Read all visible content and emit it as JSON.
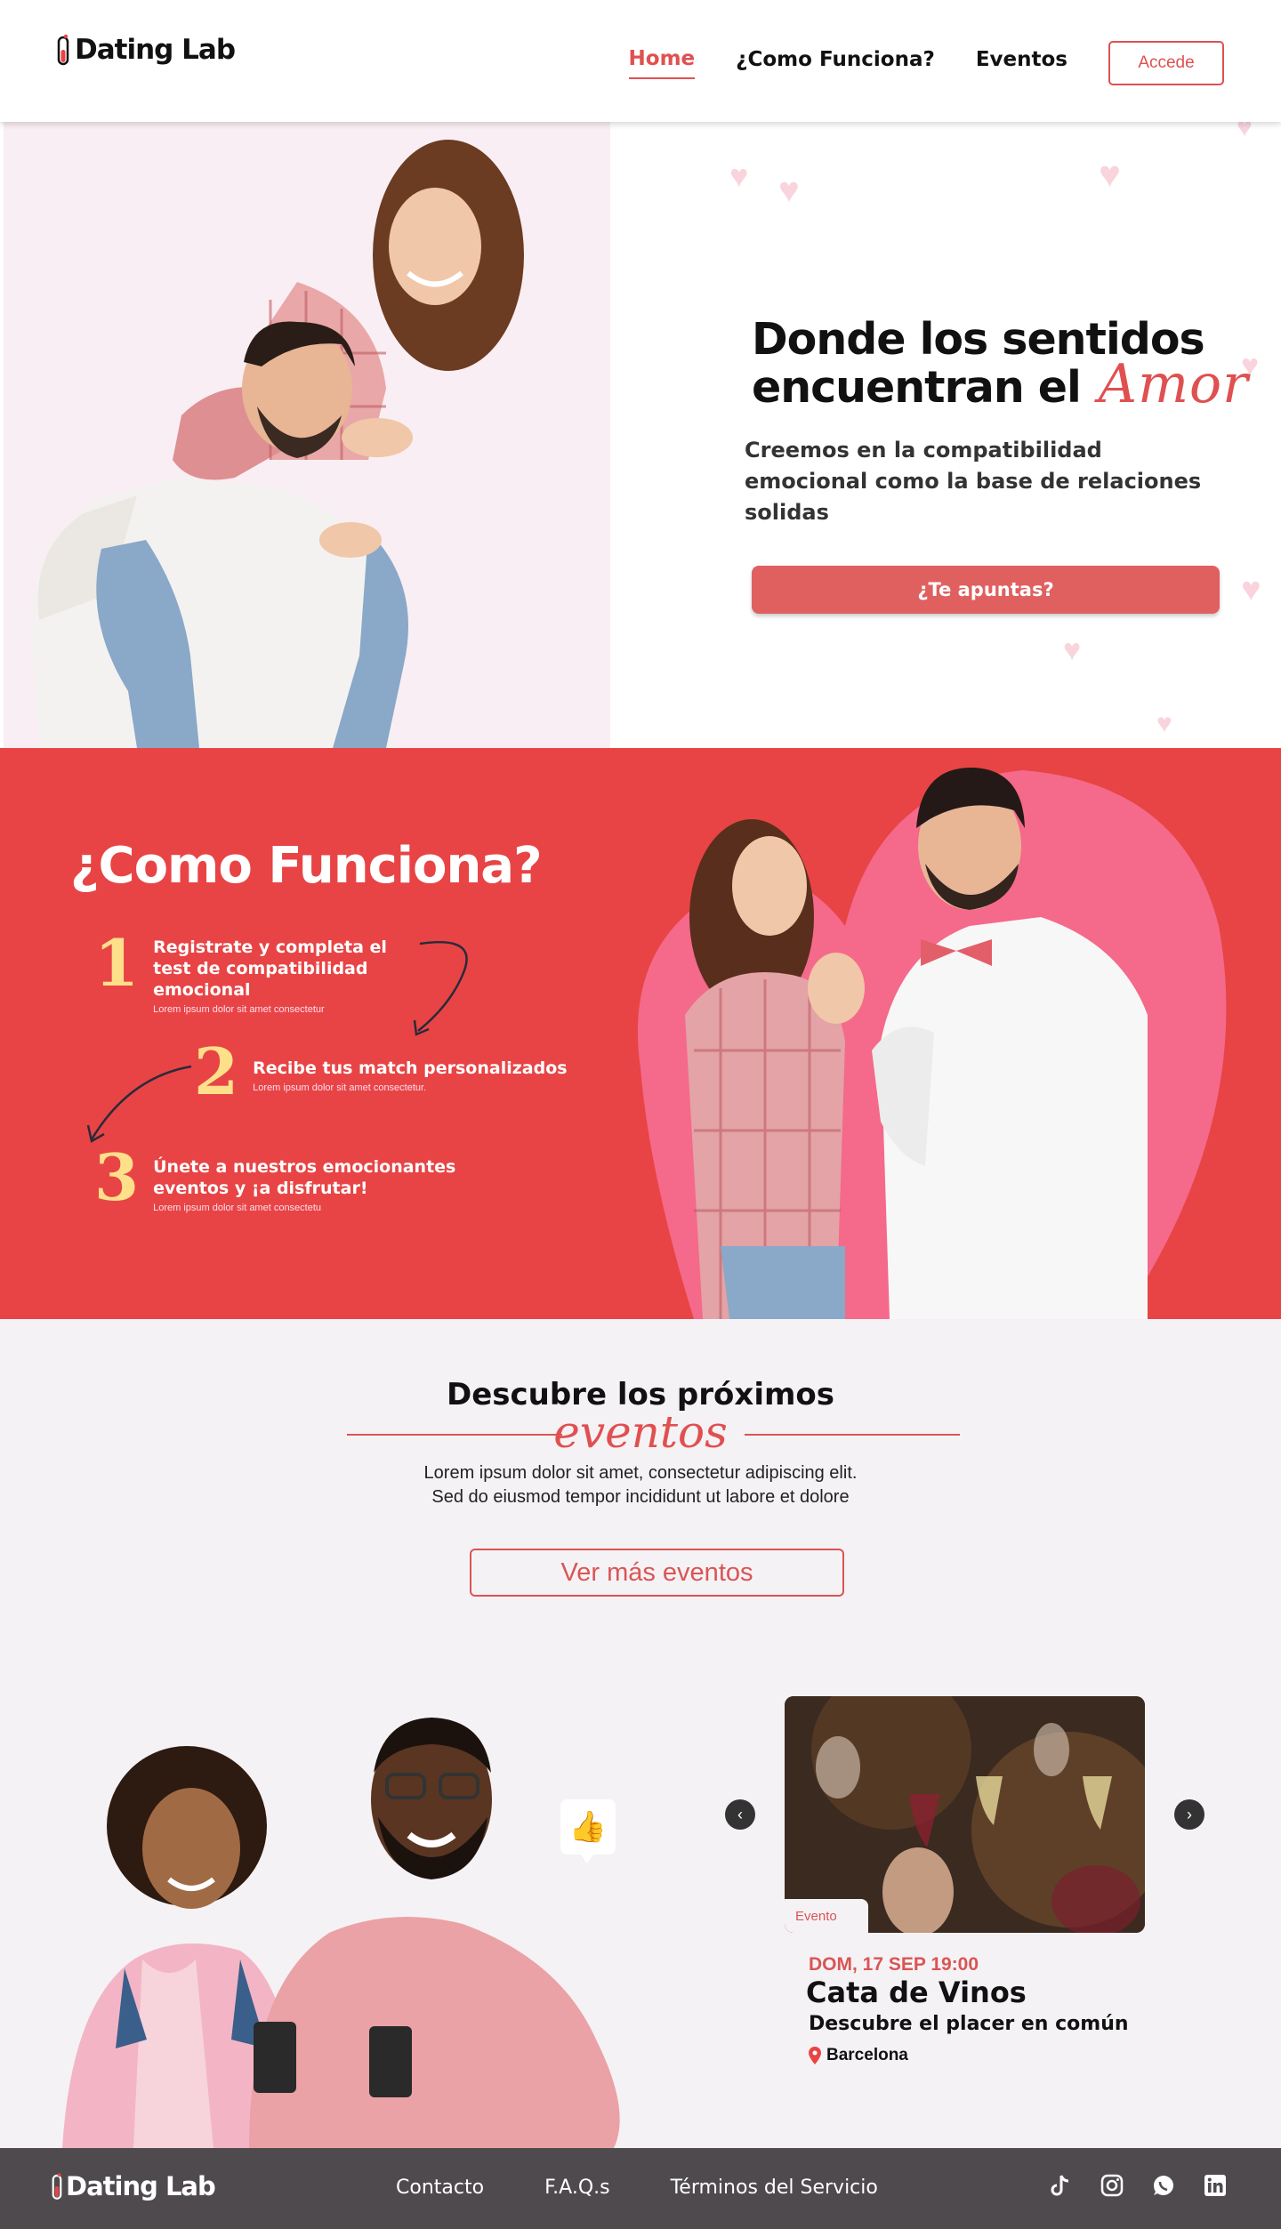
{
  "brand": {
    "name": "Dating Lab",
    "accent": "#e05050",
    "red_bg": "#e84445",
    "yellow": "#ffe08a"
  },
  "nav": {
    "items": [
      {
        "label": "Home",
        "active": true
      },
      {
        "label": "¿Como Funciona?",
        "active": false
      },
      {
        "label": "Eventos",
        "active": false
      }
    ],
    "cta": "Accede"
  },
  "hero": {
    "title_line1": "Donde los sentidos",
    "title_line2": "encuentran el",
    "title_script": "Amor",
    "subtitle": "Creemos en la compatibilidad emocional como la base de relaciones solidas",
    "cta": "¿Te apuntas?"
  },
  "how": {
    "title": "¿Como Funciona?",
    "steps": [
      {
        "num": "1",
        "title": "Registrate y completa el test de compatibilidad emocional",
        "desc": "Lorem ipsum dolor sit amet consectetur"
      },
      {
        "num": "2",
        "title": "Recibe tus match personalizados",
        "desc": "Lorem ipsum dolor sit amet consectetur."
      },
      {
        "num": "3",
        "title": "Únete a nuestros emocionantes eventos y ¡a disfrutar!",
        "desc": "Lorem ipsum dolor sit amet consectetu"
      }
    ]
  },
  "events": {
    "title": "Descubre los próximos",
    "title_script": "eventos",
    "desc_line1": "Lorem ipsum dolor sit amet, consectetur adipiscing elit.",
    "desc_line2": "Sed do eiusmod tempor incididunt ut labore et dolore",
    "cta": "Ver más eventos",
    "card": {
      "tag": "Evento",
      "date": "DOM, 17 SEP 19:00",
      "name": "Cata de Vinos",
      "tagline": "Descubre el placer en común",
      "location": "Barcelona"
    }
  },
  "footer": {
    "brand": "Dating Lab",
    "links": [
      "Contacto",
      "F.A.Q.s",
      "Términos del Servicio"
    ],
    "social": [
      "tiktok-icon",
      "instagram-icon",
      "whatsapp-icon",
      "linkedin-icon"
    ]
  }
}
